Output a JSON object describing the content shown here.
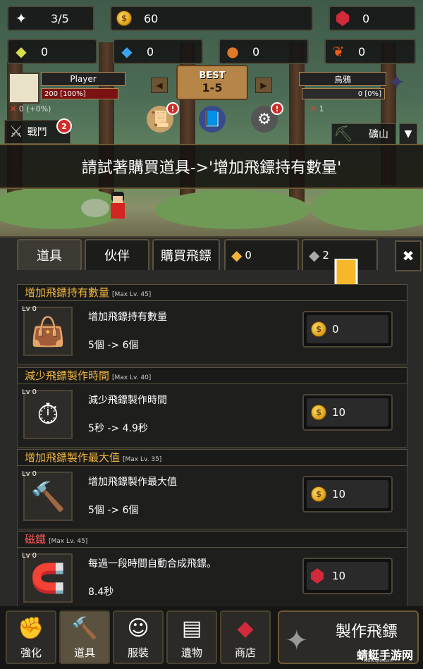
{
  "resources": {
    "shuriken_count": "3/5",
    "gold": "60",
    "ruby": "0",
    "green_gem": "0",
    "diamond": "0",
    "orb": "0",
    "feather": "0"
  },
  "player": {
    "name": "Player",
    "hp": "200 [100%]",
    "stat": "0 (+0%)"
  },
  "enemy": {
    "name": "烏鴉",
    "hp": "0 [0%]",
    "count": "1"
  },
  "stage": {
    "best_label": "BEST",
    "stage": "1-5"
  },
  "battle": {
    "label": "戰鬥",
    "badge": "2"
  },
  "location": {
    "label": "礦山",
    "dropdown": "▼"
  },
  "banner": {
    "text": "請試著購買道具->'增加飛鏢持有數量'"
  },
  "tabs": {
    "items": "道具",
    "partner": "伙伴",
    "buy": "購買飛鏢",
    "res1": "0",
    "res2": "2"
  },
  "close_label": "✖",
  "shop": [
    {
      "title": "增加飛鏢持有數量",
      "max": "[Max Lv. 45]",
      "lv": "Lv 0",
      "name": "增加飛鏢持有數量",
      "effect": "5個 -> 6個",
      "price": "0",
      "currency": "gold",
      "icon": "bag-icon"
    },
    {
      "title": "減少飛鏢製作時間",
      "max": "[Max Lv. 40]",
      "lv": "Lv 0",
      "name": "減少飛鏢製作時間",
      "effect": "5秒 -> 4.9秒",
      "price": "10",
      "currency": "gold",
      "icon": "stopwatch-icon"
    },
    {
      "title": "增加飛鏢製作最大值",
      "max": "[Max Lv. 35]",
      "lv": "Lv 0",
      "name": "增加飛鏢製作最大值",
      "effect": "5個 -> 6個",
      "price": "10",
      "currency": "gold",
      "icon": "hammer-icon"
    },
    {
      "title": "磁鐵",
      "max": "[Max Lv. 45]",
      "lv": "Lv 0",
      "name": "每過一段時間自動合成飛鏢。",
      "effect": "8.4秒",
      "price": "10",
      "currency": "ruby",
      "icon": "magnet-icon"
    }
  ],
  "nav": {
    "enhance": "強化",
    "items": "道具",
    "costume": "服裝",
    "relic": "遺物",
    "store": "商店",
    "craft": "製作飛鏢"
  },
  "watermark": {
    "text": "蜻蜓手游网",
    "sub": "www.qt6.com"
  },
  "colors": {
    "accent": "#f0b43c",
    "ruby": "#d22a3a",
    "gold": "#e0a619"
  }
}
